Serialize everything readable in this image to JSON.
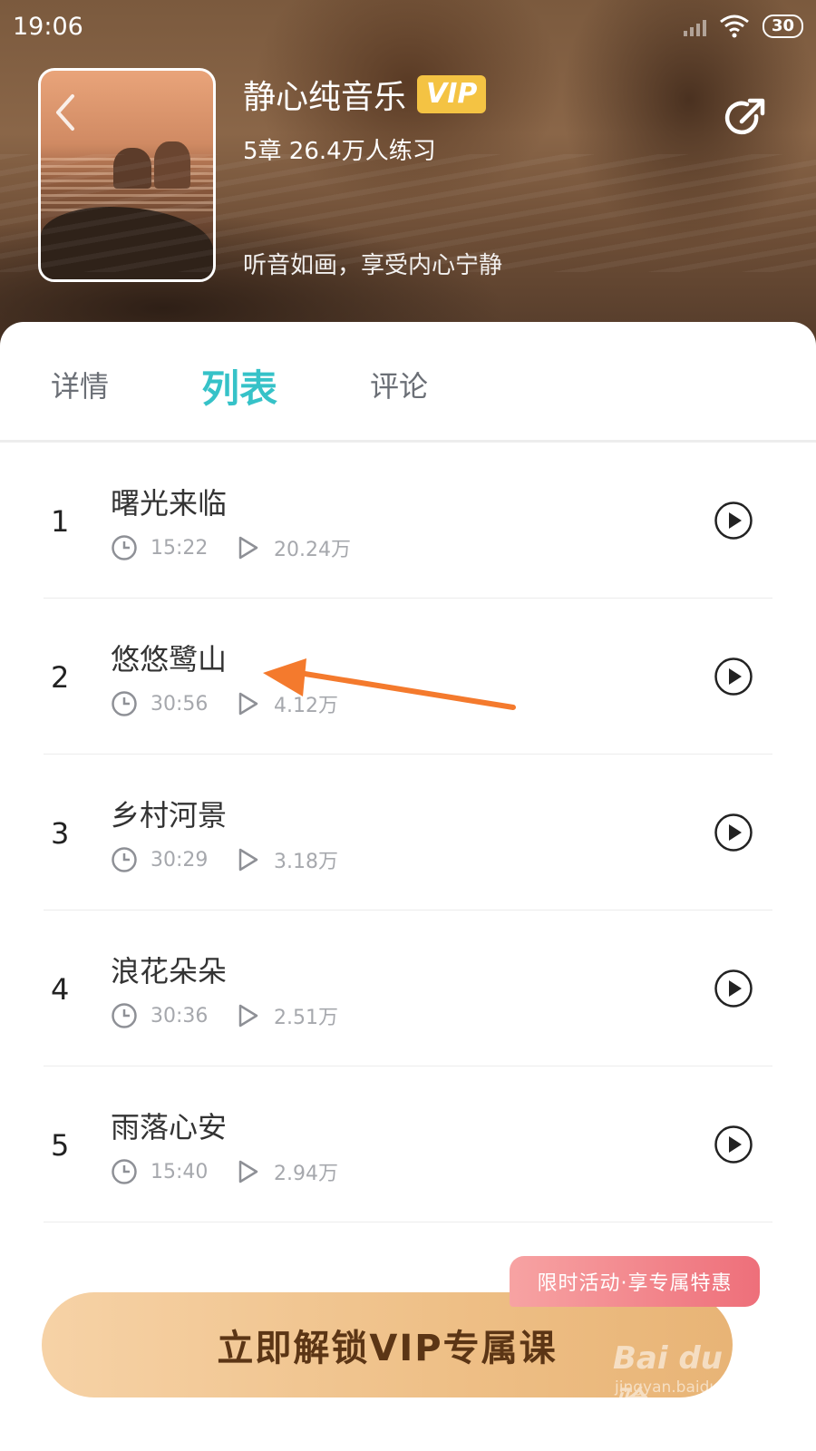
{
  "status_bar": {
    "time": "19:06",
    "battery": "30"
  },
  "header": {
    "title": "静心纯音乐",
    "vip_badge": "VIP",
    "stats": "5章 26.4万人练习",
    "description": "听音如画，享受内心宁静"
  },
  "tabs": [
    {
      "label": "详情",
      "active": false
    },
    {
      "label": "列表",
      "active": true
    },
    {
      "label": "评论",
      "active": false
    }
  ],
  "tracks": [
    {
      "number": "1",
      "title": "曙光来临",
      "duration": "15:22",
      "plays": "20.24万"
    },
    {
      "number": "2",
      "title": "悠悠鹭山",
      "duration": "30:56",
      "plays": "4.12万"
    },
    {
      "number": "3",
      "title": "乡村河景",
      "duration": "30:29",
      "plays": "3.18万"
    },
    {
      "number": "4",
      "title": "浪花朵朵",
      "duration": "30:36",
      "plays": "2.51万"
    },
    {
      "number": "5",
      "title": "雨落心安",
      "duration": "15:40",
      "plays": "2.94万"
    }
  ],
  "promo_tag": "限时活动·享专属特惠",
  "cta_label": "立即解锁VIP专属课",
  "watermark": {
    "logo": "Bai du 经验",
    "url": "jingyan.baidu.com"
  },
  "colors": {
    "accent_teal": "#36c2c8",
    "vip_gold": "#f4c343",
    "cta_gold": "#eebf86",
    "promo_pink": "#ee6f7a",
    "annotation_arrow": "#f47a2d"
  }
}
